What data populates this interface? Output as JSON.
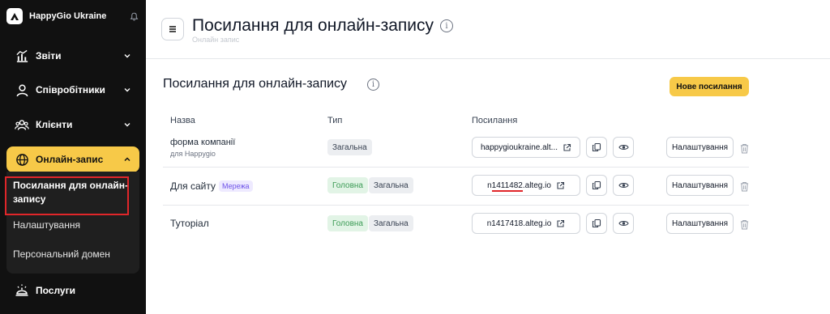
{
  "sidebar": {
    "brand": "HappyGio Ukraine",
    "items": [
      {
        "label": "Звіти"
      },
      {
        "label": "Співробітники"
      },
      {
        "label": "Клієнти"
      },
      {
        "label": "Онлайн-запис"
      },
      {
        "label": "Послуги"
      }
    ],
    "submenu": [
      {
        "label": "Посилання для онлайн-запису"
      },
      {
        "label": "Налаштування"
      },
      {
        "label": "Персональний домен"
      }
    ],
    "active_color": "#f7c948"
  },
  "header": {
    "title": "Посилання для онлайн-запису",
    "breadcrumb": "Онлайн запис"
  },
  "section": {
    "title": "Посилання для онлайн-запису",
    "new_button": "Нове посилання"
  },
  "table": {
    "headers": [
      "Назва",
      "Тип",
      "Посилання"
    ],
    "rows": [
      {
        "name": "форма компанії",
        "subtitle": "для Happygio",
        "badge": "",
        "types": [
          "Загальна"
        ],
        "link": "happygioukraine.alt...",
        "settings": "Налаштування"
      },
      {
        "name": "Для сайту",
        "subtitle": "",
        "badge": "Мережа",
        "types": [
          "Головна",
          "Загальна"
        ],
        "link_prefix": "n",
        "link_marked": "1411482",
        "link_suffix": ".alteg.io",
        "settings": "Налаштування"
      },
      {
        "name": "Туторіал",
        "subtitle": "",
        "badge": "",
        "types": [
          "Головна",
          "Загальна"
        ],
        "link": "n1417418.alteg.io",
        "settings": "Налаштування"
      }
    ]
  }
}
